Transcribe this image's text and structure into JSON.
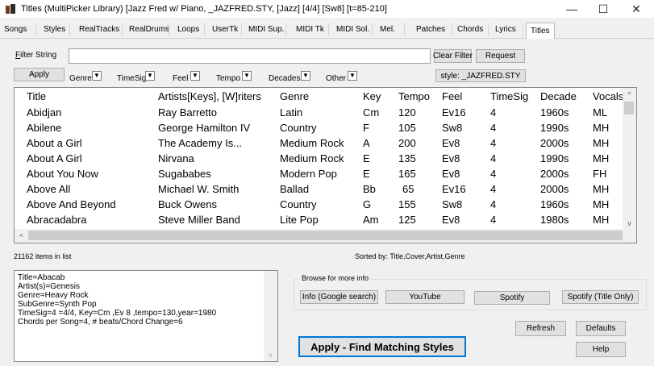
{
  "window": {
    "title": "Titles  (MultiPicker Library)  [Jazz Fred w/ Piano, _JAZFRED.STY,  [Jazz] [4/4] [Sw8] [t=85-210]",
    "minimize": "—",
    "maximize": "☐",
    "close": "✕"
  },
  "tabs": [
    "Songs",
    "Styles",
    "RealTracks",
    "RealDrums",
    "Loops",
    "UserTk",
    "MIDI Sup.",
    "MIDI Tk",
    "MIDI Sol.",
    "Mel.",
    "Patches",
    "Chords",
    "Lyrics",
    "Titles"
  ],
  "active_tab": "Titles",
  "filter": {
    "label_prefix": "F",
    "label_rest": "ilter String",
    "value": "",
    "clear_button": "Clear Filter",
    "request_button": "Request",
    "apply_button": "Apply",
    "dropdowns": [
      "Genre",
      "TimeSig",
      "Feel",
      "Tempo",
      "Decades",
      "Other"
    ],
    "dropdown_arrow": "▼",
    "style_button": "style:  _JAZFRED.STY"
  },
  "table": {
    "columns": [
      "Title",
      "Artists[Keys], [W]riters",
      "Genre",
      "Key",
      "Tempo",
      "Feel",
      "TimeSig",
      "Decade",
      "Vocals"
    ],
    "rows": [
      [
        "Abidjan",
        "Ray Barretto",
        "Latin",
        "Cm",
        "120",
        "Ev16",
        "4",
        "1960s",
        "ML"
      ],
      [
        "Abilene",
        "George Hamilton IV",
        "Country",
        "F",
        "105",
        "Sw8",
        "4",
        "1990s",
        "MH"
      ],
      [
        "About a Girl",
        "The Academy Is...",
        "Medium Rock",
        "A",
        "200",
        "Ev8",
        "4",
        "2000s",
        "MH"
      ],
      [
        "About A Girl",
        "Nirvana",
        "Medium Rock",
        "E",
        "135",
        "Ev8",
        "4",
        "1990s",
        "MH"
      ],
      [
        "About You Now",
        "Sugababes",
        "Modern Pop",
        "E",
        "165",
        "Ev8",
        "4",
        "2000s",
        "FH"
      ],
      [
        "Above All",
        "Michael W. Smith",
        "Ballad",
        "Bb",
        "65",
        "Ev16",
        "4",
        "2000s",
        "MH"
      ],
      [
        "Above And Beyond",
        "Buck Owens",
        "Country",
        "G",
        "155",
        "Sw8",
        "4",
        "1960s",
        "MH"
      ],
      [
        "Abracadabra",
        "Steve Miller Band",
        "Lite Pop",
        "Am",
        "125",
        "Ev8",
        "4",
        "1980s",
        "MH"
      ]
    ],
    "scroll_up": "^",
    "scroll_down": "v",
    "scroll_left": "<",
    "scroll_right": ">"
  },
  "status": {
    "count": "21162 items in list",
    "sorted": "Sorted by: Title,Cover,Artist,Genre"
  },
  "info": {
    "lines": [
      "Title=Abacab",
      "Artist(s)=Genesis",
      "Genre=Heavy Rock",
      "SubGenre=Synth Pop",
      "TimeSig=4 =4/4, Key=Cm ,Ev 8 ,tempo=130,year=1980",
      "Chords per Song=4, # beats/Chord Change=6"
    ],
    "scroll_down": "v"
  },
  "browse": {
    "label": "Browse for more info",
    "google": "Info (Google search)",
    "youtube": "YouTube",
    "spotify": "Spotify",
    "spotify_title": "Spotify (Title Only)"
  },
  "actions": {
    "refresh": "Refresh",
    "defaults": "Defaults",
    "help": "Help",
    "apply_find": "Apply - Find Matching Styles"
  }
}
